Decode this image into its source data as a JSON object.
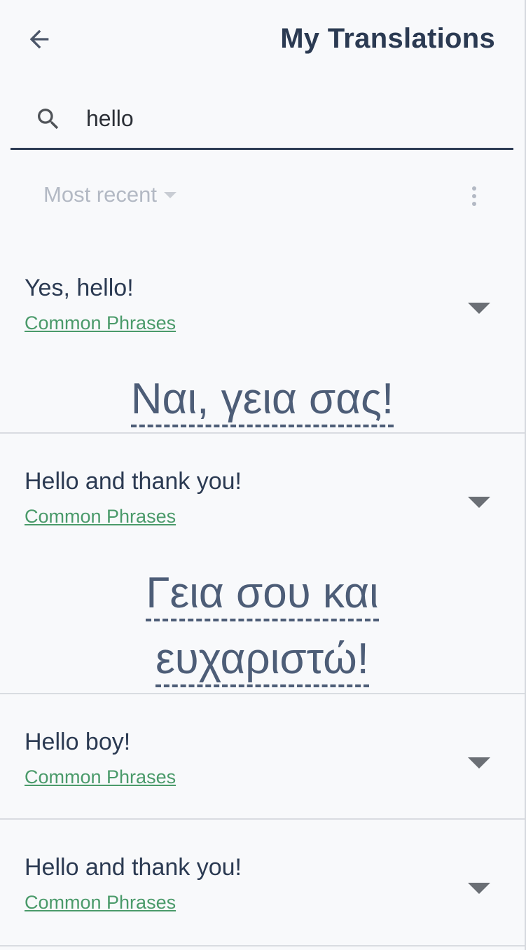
{
  "header": {
    "title": "My Translations",
    "back_icon": "arrow-left-icon"
  },
  "search": {
    "value": "hello",
    "placeholder": "",
    "icon": "search-icon"
  },
  "sort": {
    "label": "Most recent",
    "more_icon": "more-vertical-icon"
  },
  "items": [
    {
      "title": "Yes, hello!",
      "category": "Common Phrases",
      "translation_lines": [
        "Ναι, γεια σας!"
      ],
      "expanded": true
    },
    {
      "title": "Hello and thank you!",
      "category": "Common Phrases",
      "translation_lines": [
        "Γεια σου και",
        "ευχαριστώ!"
      ],
      "expanded": true
    },
    {
      "title": "Hello boy!",
      "category": "Common Phrases",
      "translation_lines": [],
      "expanded": false
    },
    {
      "title": "Hello and thank you!",
      "category": "Common Phrases",
      "translation_lines": [],
      "expanded": false
    }
  ],
  "colors": {
    "background": "#f8f9fb",
    "text_primary": "#2b3a52",
    "category_link": "#4a9a6a",
    "translation": "#4d5d77",
    "muted": "#b3b9c4"
  }
}
